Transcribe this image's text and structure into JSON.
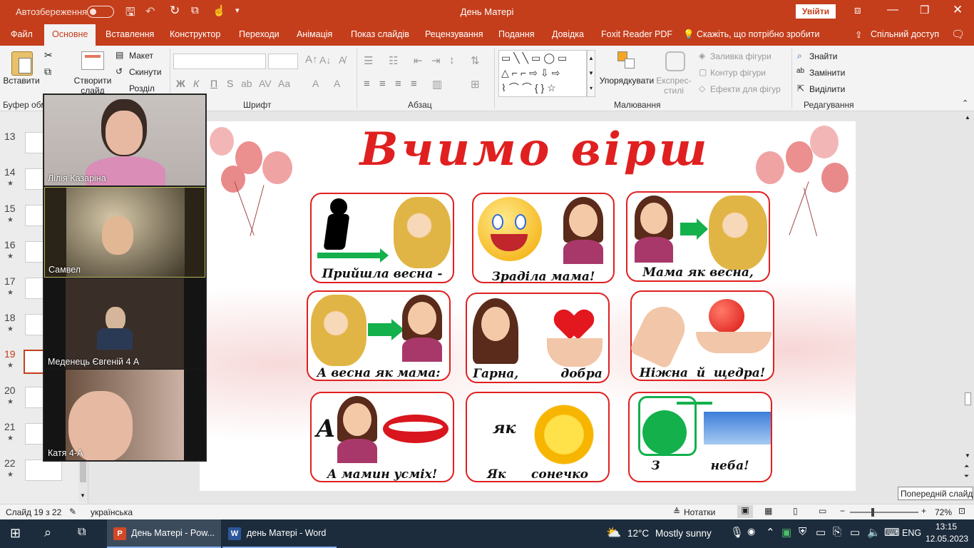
{
  "titlebar": {
    "autosave_label": "Автозбереження",
    "doc_title": "День Матері",
    "signin_label": "Увійти"
  },
  "tabs": [
    "Файл",
    "Основне",
    "Вставлення",
    "Конструктор",
    "Переходи",
    "Анімація",
    "Показ слайдів",
    "Рецензування",
    "Подання",
    "Довідка",
    "Foxit Reader PDF"
  ],
  "tell_me": "Скажіть, що потрібно зробити",
  "share": "Спільний доступ",
  "ribbon": {
    "paste": "Вставити",
    "clipboard_group": "Буфер обм",
    "new_slide": "Створити слайд",
    "layout": "Макет",
    "reset": "Скинути",
    "section": "Розділ",
    "font_group": "Шрифт",
    "paragraph_group": "Абзац",
    "drawing_group": "Малювання",
    "arrange": "Упорядкувати",
    "quick_styles": "Експрес-стилі",
    "shape_fill": "Заливка фігури",
    "shape_outline": "Контур фігури",
    "shape_effects": "Ефекти для фігур",
    "find": "Знайти",
    "replace": "Замінити",
    "select": "Виділити",
    "editing_group": "Редагування",
    "bold": "Ж",
    "italic": "К",
    "underline": "П",
    "strike": "S"
  },
  "thumbnails": [
    {
      "num": "13",
      "star": ""
    },
    {
      "num": "14",
      "star": "★"
    },
    {
      "num": "15",
      "star": "★"
    },
    {
      "num": "16",
      "star": "★"
    },
    {
      "num": "17",
      "star": "★"
    },
    {
      "num": "18",
      "star": "★"
    },
    {
      "num": "19",
      "star": "★"
    },
    {
      "num": "20",
      "star": "★"
    },
    {
      "num": "21",
      "star": "★"
    },
    {
      "num": "22",
      "star": "★"
    }
  ],
  "video_participants": [
    "Лілія Казаріна",
    "Самвел",
    "Меденець Євгеній 4 А",
    "Катя  4-А"
  ],
  "slide": {
    "title": "Вчимо вірш",
    "captions": [
      "Прийшла весна -",
      "Зраділа мама!",
      "Мама як весна,",
      "А весна як мама:",
      "Гарна,          добра",
      "Ніжна  й  щедра!",
      "А мамин усміх!",
      "Як      сонечко",
      "З            неба!"
    ],
    "card7_letter": "А",
    "card8_word": "як"
  },
  "tooltip": "Попередній слайд",
  "status": {
    "slide_info": "Слайд 19 з 22",
    "language": "українська",
    "notes": "Нотатки",
    "zoom": "72%"
  },
  "taskbar": {
    "ppt_task": "День Матері - Pow...",
    "word_task": "день Матері - Word",
    "weather_temp": "12°C",
    "weather_text": "Mostly sunny",
    "lang": "ENG",
    "time": "13:15",
    "date": "12.05.2023"
  },
  "colors": {
    "accent": "#c43e1c",
    "slide_red": "#e02020",
    "arrow_green": "#13b04c"
  }
}
